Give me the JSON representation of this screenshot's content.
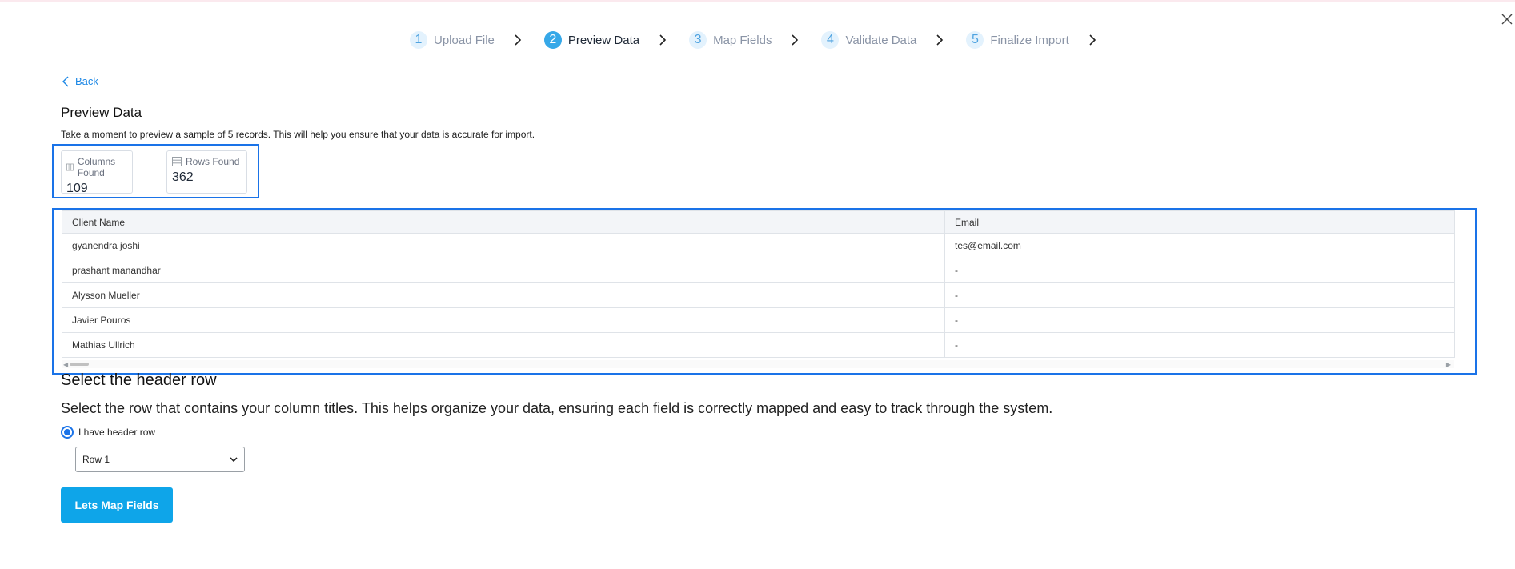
{
  "steps": [
    {
      "num": "1",
      "label": "Upload File"
    },
    {
      "num": "2",
      "label": "Preview Data"
    },
    {
      "num": "3",
      "label": "Map Fields"
    },
    {
      "num": "4",
      "label": "Validate Data"
    },
    {
      "num": "5",
      "label": "Finalize Import"
    }
  ],
  "back_label": "Back",
  "preview": {
    "title": "Preview Data",
    "description": "Take a moment to preview a sample of 5 records. This will help you ensure that your data is accurate for import."
  },
  "stats": {
    "columns_label": "Columns Found",
    "columns_value": "109",
    "rows_label": "Rows Found",
    "rows_value": "362"
  },
  "table": {
    "headers": [
      "Client Name",
      "Email"
    ],
    "rows": [
      [
        "gyanendra joshi",
        "tes@email.com"
      ],
      [
        "prashant manandhar",
        "-"
      ],
      [
        "Alysson Mueller",
        "-"
      ],
      [
        "Javier Pouros",
        "-"
      ],
      [
        "Mathias Ullrich",
        "-"
      ]
    ]
  },
  "header_row": {
    "title": "Select the header row",
    "description": "Select the row that contains your column titles. This helps organize your data, ensuring each field is correctly mapped and easy to track through the system.",
    "radio_label": "I have header row",
    "selected_row": "Row 1"
  },
  "primary_button": "Lets Map Fields",
  "colors": {
    "accent": "#1a73e8",
    "button": "#0ea5e9",
    "step_active": "#36a8e8"
  }
}
